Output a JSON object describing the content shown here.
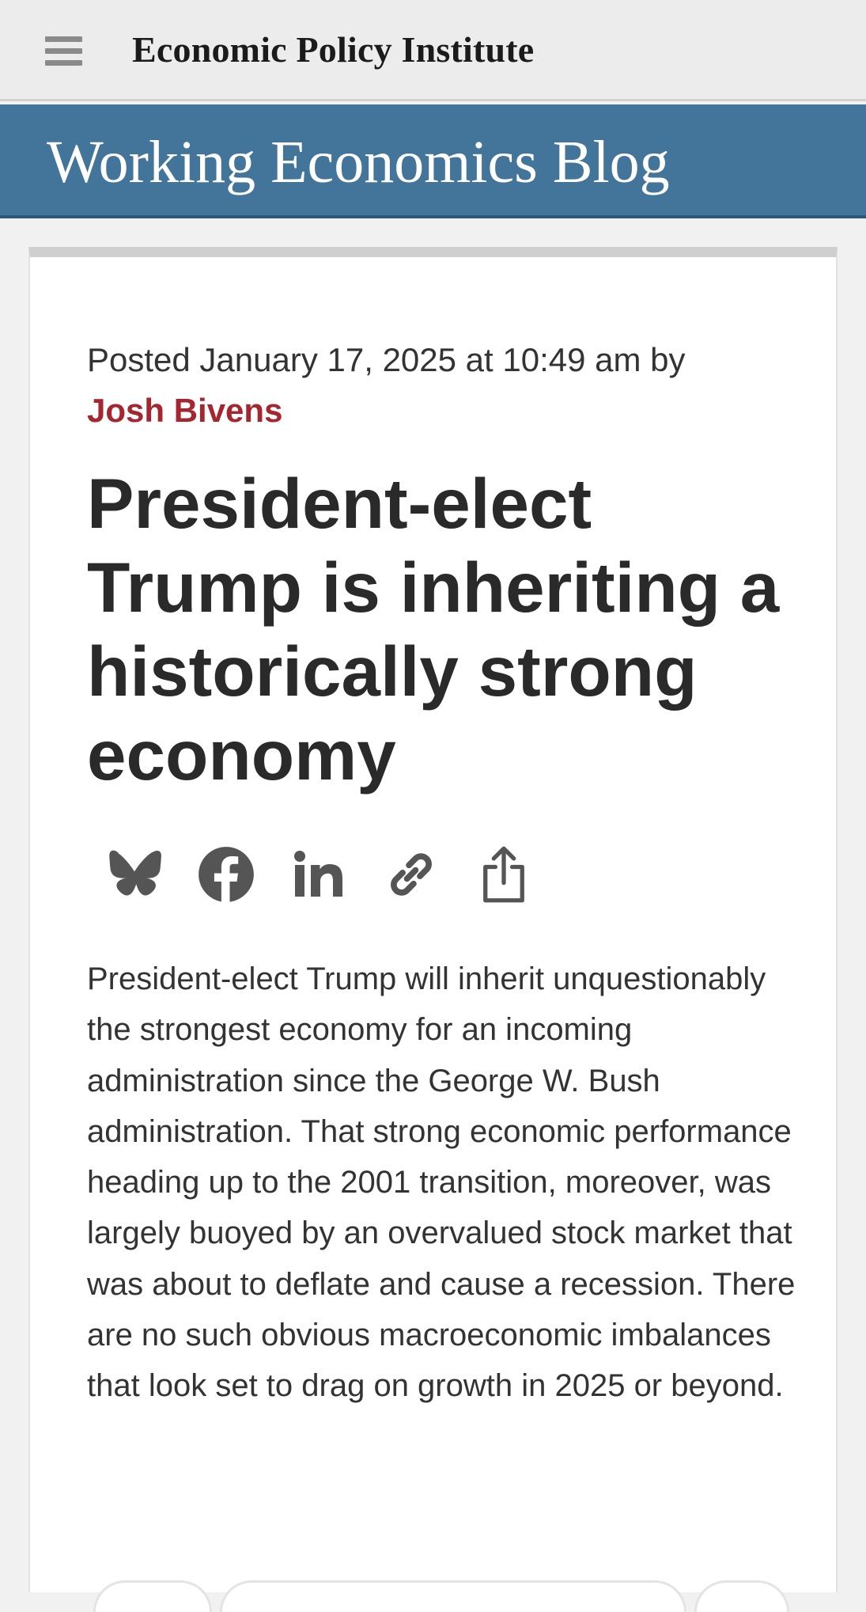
{
  "header": {
    "menu_icon": "hamburger-menu-icon",
    "site_title": "Economic Policy Institute"
  },
  "banner": {
    "blog_title": "Working Economics Blog"
  },
  "article": {
    "byline_prefix": "Posted January 17, 2025 at 10:49 am by",
    "author": "Josh Bivens",
    "headline": "President-elect Trump is inheriting a historically strong economy",
    "share_icons": [
      "bluesky-icon",
      "facebook-icon",
      "linkedin-icon",
      "copy-link-icon",
      "share-icon"
    ],
    "body": "President-elect Trump will inherit unquestionably the strongest economy for an incoming administration since the George W. Bush administration. That strong economic performance heading up to the 2001 transition, moreover, was largely buoyed by an overvalued stock market that was about to deflate and cause a recession. There are no such obvious macroeconomic imbalances that look set to drag on growth in 2025 or beyond."
  },
  "colors": {
    "banner": "#43759a",
    "author": "#a5262f",
    "icons": "#555555"
  }
}
